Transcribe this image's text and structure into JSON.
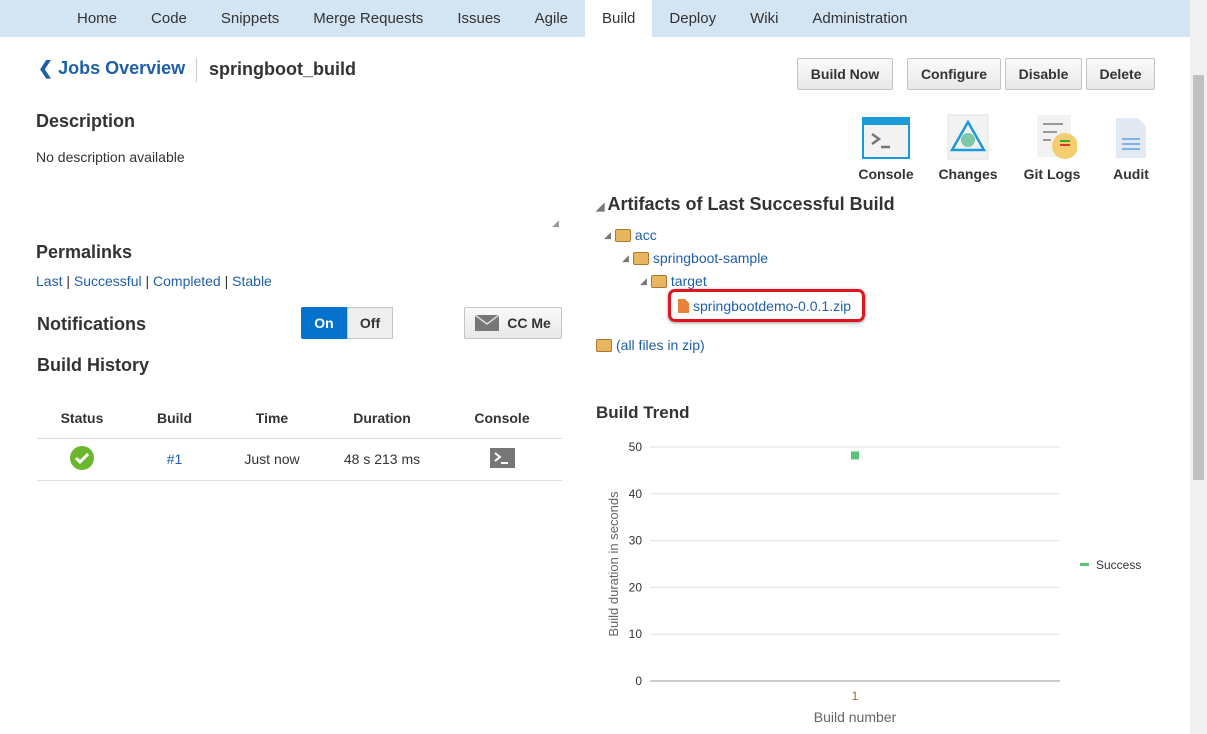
{
  "nav": {
    "items": [
      "Home",
      "Code",
      "Snippets",
      "Merge Requests",
      "Issues",
      "Agile",
      "Build",
      "Deploy",
      "Wiki",
      "Administration"
    ],
    "active": "Build"
  },
  "header": {
    "back_label": "Jobs Overview",
    "job_name": "springboot_build"
  },
  "actions": {
    "build_now": "Build Now",
    "configure": "Configure",
    "disable": "Disable",
    "delete": "Delete"
  },
  "tools": {
    "console": "Console",
    "changes": "Changes",
    "git_logs": "Git Logs",
    "audit": "Audit"
  },
  "description": {
    "title": "Description",
    "text": "No description available"
  },
  "permalinks": {
    "title": "Permalinks",
    "items": [
      "Last",
      "Successful",
      "Completed",
      "Stable"
    ]
  },
  "notifications": {
    "title": "Notifications",
    "on": "On",
    "off": "Off",
    "cc_me": "CC Me"
  },
  "history": {
    "title": "Build History",
    "columns": [
      "Status",
      "Build",
      "Time",
      "Duration",
      "Console"
    ],
    "rows": [
      {
        "status": "success",
        "build": "#1",
        "time": "Just now",
        "duration": "48 s 213 ms"
      }
    ]
  },
  "artifacts": {
    "title": "Artifacts of Last Successful Build",
    "tree": [
      "acc",
      "springboot-sample",
      "target"
    ],
    "file": "springbootdemo-0.0.1.zip",
    "all_files": "(all files in zip)"
  },
  "trend": {
    "title": "Build Trend"
  },
  "colors": {
    "accent": "#0572ce",
    "success": "#5bc27a"
  },
  "chart_data": {
    "type": "scatter",
    "title": "Build Trend",
    "xlabel": "Build number",
    "ylabel": "Build duration in seconds",
    "ylim": [
      0,
      50
    ],
    "yticks": [
      0,
      10,
      20,
      30,
      40,
      50
    ],
    "categories": [
      "1"
    ],
    "series": [
      {
        "name": "Success",
        "values": [
          48.2
        ]
      }
    ],
    "legend": "right",
    "grid": true
  }
}
